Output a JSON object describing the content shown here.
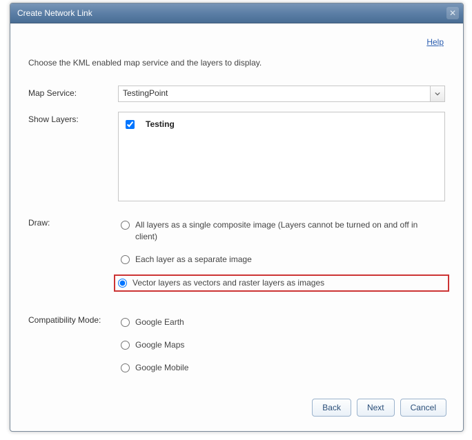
{
  "dialog": {
    "title": "Create Network Link",
    "help_label": "Help",
    "instruction": "Choose the KML enabled map service and the layers to display."
  },
  "fields": {
    "map_service": {
      "label": "Map Service:",
      "value": "TestingPoint"
    },
    "show_layers": {
      "label": "Show Layers:",
      "items": [
        {
          "name": "Testing",
          "checked": true
        }
      ]
    },
    "draw": {
      "label": "Draw:",
      "options": [
        "All layers as a single composite image (Layers cannot be turned on and off in client)",
        "Each layer as a separate image",
        "Vector layers as vectors and raster layers as images"
      ],
      "selected_index": 2
    },
    "compat": {
      "label": "Compatibility Mode:",
      "options": [
        "Google Earth",
        "Google Maps",
        "Google Mobile"
      ],
      "selected_index": null
    }
  },
  "buttons": {
    "back": "Back",
    "next": "Next",
    "cancel": "Cancel"
  },
  "colors": {
    "titlebar_gradient_top": "#7895b7",
    "titlebar_gradient_bottom": "#496d94",
    "highlight_border": "#cc3333",
    "link": "#2a5db0",
    "button_border": "#9ab2cc"
  }
}
